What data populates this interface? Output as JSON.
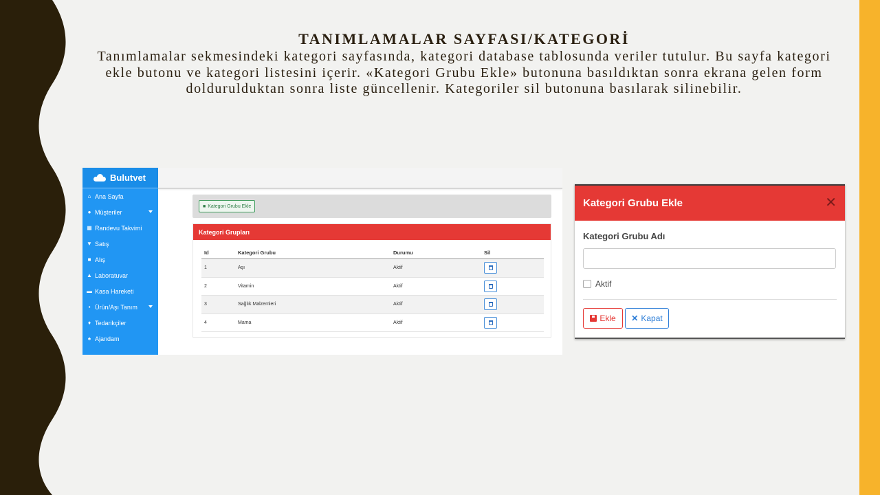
{
  "slide": {
    "title": "TANIMLAMALAR SAYFASI/KATEGORİ",
    "body": "Tanımlamalar sekmesindeki kategori sayfasında, kategori database tablosunda veriler tutulur. Bu sayfa kategori ekle butonu ve kategori listesini içerir. «Kategori Grubu Ekle» butonuna basıldıktan sonra ekrana gelen form doldurulduktan sonra liste güncellenir. Kategoriler sil butonuna basılarak silinebilir."
  },
  "app": {
    "brand": "Bulutvet",
    "sidebar": [
      {
        "label": "Ana Sayfa",
        "icon": "home-icon"
      },
      {
        "label": "Müşteriler",
        "icon": "users-icon",
        "has_submenu": true
      },
      {
        "label": "Randevu Takvimi",
        "icon": "calendar-icon"
      },
      {
        "label": "Satış",
        "icon": "cart-icon"
      },
      {
        "label": "Alış",
        "icon": "truck-icon"
      },
      {
        "label": "Laboratuvar",
        "icon": "flask-icon"
      },
      {
        "label": "Kasa Hareketi",
        "icon": "money-icon"
      },
      {
        "label": "Ürün/Aşı Tanım",
        "icon": "sitemap-icon",
        "has_submenu": true
      },
      {
        "label": "Tedarikçiler",
        "icon": "supplier-icon"
      },
      {
        "label": "Ajandam",
        "icon": "bell-icon"
      }
    ],
    "add_button": "Kategori Grubu Ekle",
    "card_title": "Kategori Grupları",
    "table": {
      "columns": [
        "Id",
        "Kategori Grubu",
        "Durumu",
        "Sil"
      ],
      "rows": [
        {
          "id": "1",
          "name": "Aşı",
          "status": "Aktif"
        },
        {
          "id": "2",
          "name": "Vitamin",
          "status": "Aktif"
        },
        {
          "id": "3",
          "name": "Sağlık Malzemleri",
          "status": "Aktif"
        },
        {
          "id": "4",
          "name": "Mama",
          "status": "Aktif"
        }
      ]
    }
  },
  "modal": {
    "title": "Kategori Grubu Ekle",
    "field_label": "Kategori Grubu Adı",
    "input_value": "",
    "checkbox_label": "Aktif",
    "checkbox_checked": false,
    "save_label": "Ekle",
    "close_label": "Kapat"
  },
  "colors": {
    "sidebar": "#2196f3",
    "header_red": "#e53935",
    "accent_yellow": "#f7b32b",
    "wave_dark": "#2a1f0a"
  }
}
